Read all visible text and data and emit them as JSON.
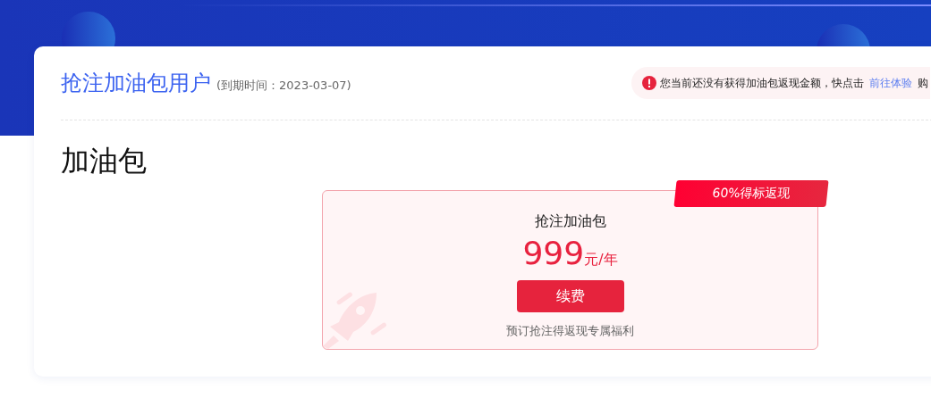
{
  "header": {
    "title": "抢注加油包用户",
    "expiry": "(到期时间：2023-03-07)"
  },
  "notice": {
    "text": "您当前还没有获得加油包返现金额，快点击",
    "link": "前往体验",
    "tail": "购"
  },
  "section_title": "加油包",
  "plan": {
    "badge": "60%得标返现",
    "name": "抢注加油包",
    "price": "999",
    "unit": "元/年",
    "button": "续费",
    "note": "预订抢注得返现专属福利"
  }
}
